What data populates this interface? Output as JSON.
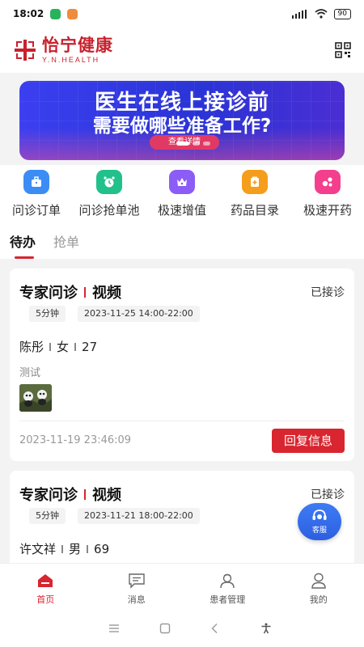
{
  "status_bar": {
    "time": "18:02",
    "battery": "90"
  },
  "header": {
    "brand_cn": "怡宁健康",
    "brand_en": "Y.N.HEALTH",
    "qr_icon": "qr-code-icon"
  },
  "banner": {
    "line1": "医生在线上接诊前",
    "line2": "需要做哪些准备工作?",
    "button": "查看详情"
  },
  "menu": [
    {
      "label": "问诊订单",
      "icon": "briefcase-icon",
      "color": "#3b8df5"
    },
    {
      "label": "问诊抢单池",
      "icon": "alarm-clock-icon",
      "color": "#22c08a"
    },
    {
      "label": "极速增值",
      "icon": "crown-icon",
      "color": "#8b5cf6"
    },
    {
      "label": "药品目录",
      "icon": "medicine-box-icon",
      "color": "#f59e1b"
    },
    {
      "label": "极速开药",
      "icon": "pills-icon",
      "color": "#f43f8e"
    }
  ],
  "tabs": [
    {
      "label": "待办",
      "active": true
    },
    {
      "label": "抢单",
      "active": false
    }
  ],
  "cards": [
    {
      "service": "专家问诊",
      "mode": "视频",
      "status": "已接诊",
      "duration": "5分钟",
      "schedule": "2023-11-25 14:00-22:00",
      "name": "陈彤",
      "gender": "女",
      "age": "27",
      "note": "测试",
      "time": "2023-11-19 23:46:09",
      "reply": "回复信息"
    },
    {
      "service": "专家问诊",
      "mode": "视频",
      "status": "已接诊",
      "duration": "5分钟",
      "schedule": "2023-11-21 18:00-22:00",
      "name": "许文祥",
      "gender": "男",
      "age": "69"
    }
  ],
  "customer_service": {
    "label": "客服"
  },
  "tabbar": [
    {
      "label": "首页",
      "icon": "home-icon",
      "active": true
    },
    {
      "label": "消息",
      "icon": "message-icon",
      "active": false
    },
    {
      "label": "患者管理",
      "icon": "patient-icon",
      "active": false
    },
    {
      "label": "我的",
      "icon": "profile-icon",
      "active": false
    }
  ],
  "colors": {
    "brand_red": "#d9252f",
    "banner_blue": "#2a34d6"
  }
}
